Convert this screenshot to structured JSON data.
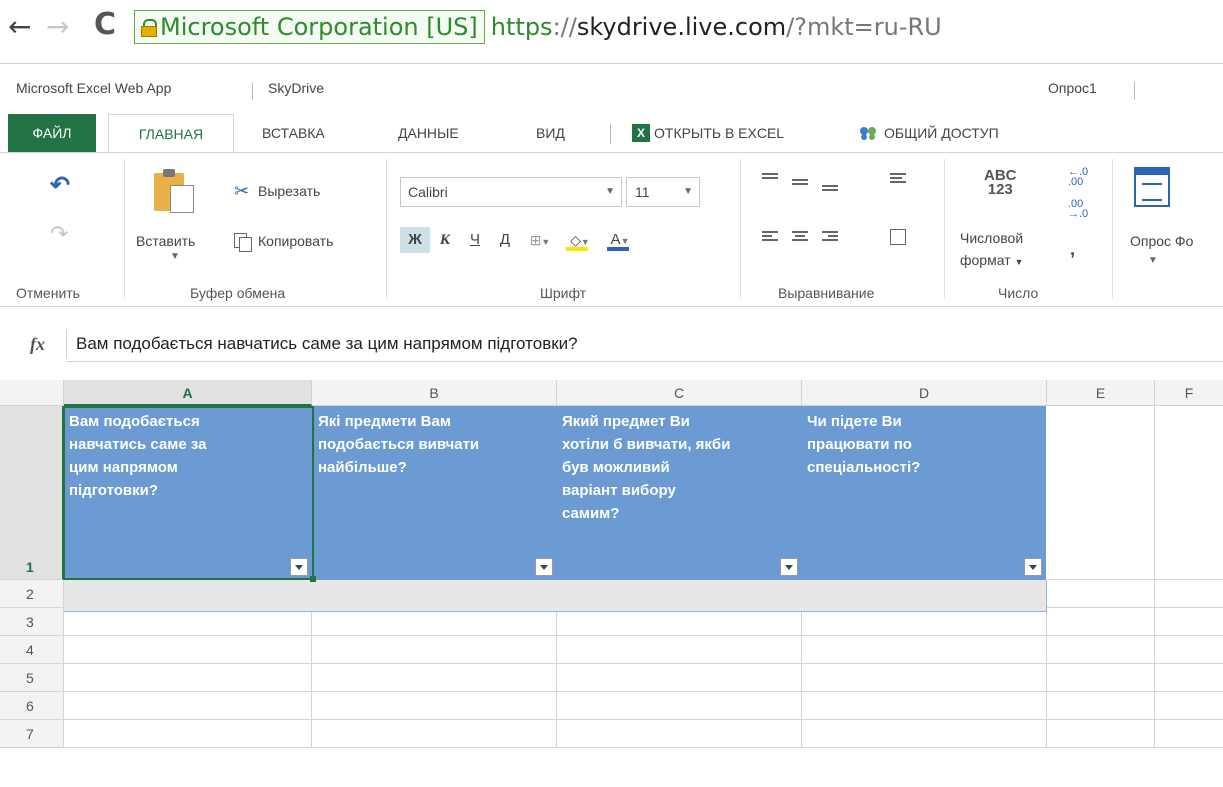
{
  "browser": {
    "back_glyph": "←",
    "forward_glyph": "→",
    "reload_glyph": "C",
    "ev_label": "Microsoft Corporation [US]",
    "url_scheme": "https",
    "url_sep": "://",
    "url_host": "skydrive.live.com",
    "url_path": "/?mkt=ru-RU"
  },
  "app": {
    "name": "Microsoft Excel Web App",
    "service": "SkyDrive",
    "document": "Опрос1"
  },
  "tabs": {
    "file": "ФАЙЛ",
    "home": "ГЛАВНАЯ",
    "insert": "ВСТАВКА",
    "data": "ДАННЫЕ",
    "view": "ВИД",
    "open_excel": "ОТКРЫТЬ В EXCEL",
    "share": "ОБЩИЙ ДОСТУП",
    "excel_icon_letter": "X"
  },
  "ribbon": {
    "undo_group": "Отменить",
    "clipboard": {
      "paste": "Вставить",
      "cut": "Вырезать",
      "copy": "Копировать",
      "group": "Буфер обмена"
    },
    "font": {
      "name": "Calibri",
      "size": "11",
      "bold": "Ж",
      "italic": "К",
      "underline": "Ч",
      "double_underline": "Д",
      "fill_glyph": "◇",
      "color_glyph": "А",
      "group": "Шрифт"
    },
    "alignment": {
      "group": "Выравнивание"
    },
    "number": {
      "abc": "ABC",
      "num": "123",
      "format_line1": "Числовой",
      "format_line2": "формат",
      "comma": ",",
      "group": "Число"
    },
    "survey": {
      "label": "Опрос Фо"
    }
  },
  "formula_bar": {
    "fx": "fx",
    "content": "Вам подобається навчатись саме за цим напрямом підготовки?"
  },
  "grid": {
    "columns": [
      "A",
      "B",
      "C",
      "D",
      "E",
      "F"
    ],
    "rows": [
      "1",
      "2",
      "3",
      "4",
      "5",
      "6",
      "7"
    ],
    "headers": [
      "Вам подобається\nнавчатись саме за\nцим напрямом\nпідготовки?",
      "Які предмети Вам\nподобається вивчати\nнайбільше?",
      "Який предмет Ви\nхотіли б вивчати, якби\nбув можливий\nваріант вибору\nсамим?",
      "Чи підете Ви\nпрацювати по\nспеціальності?"
    ],
    "active_cell": "A1"
  },
  "colors": {
    "accent": "#217346",
    "table_header": "#6b9bd2",
    "ev_green": "#2e8b2e"
  }
}
